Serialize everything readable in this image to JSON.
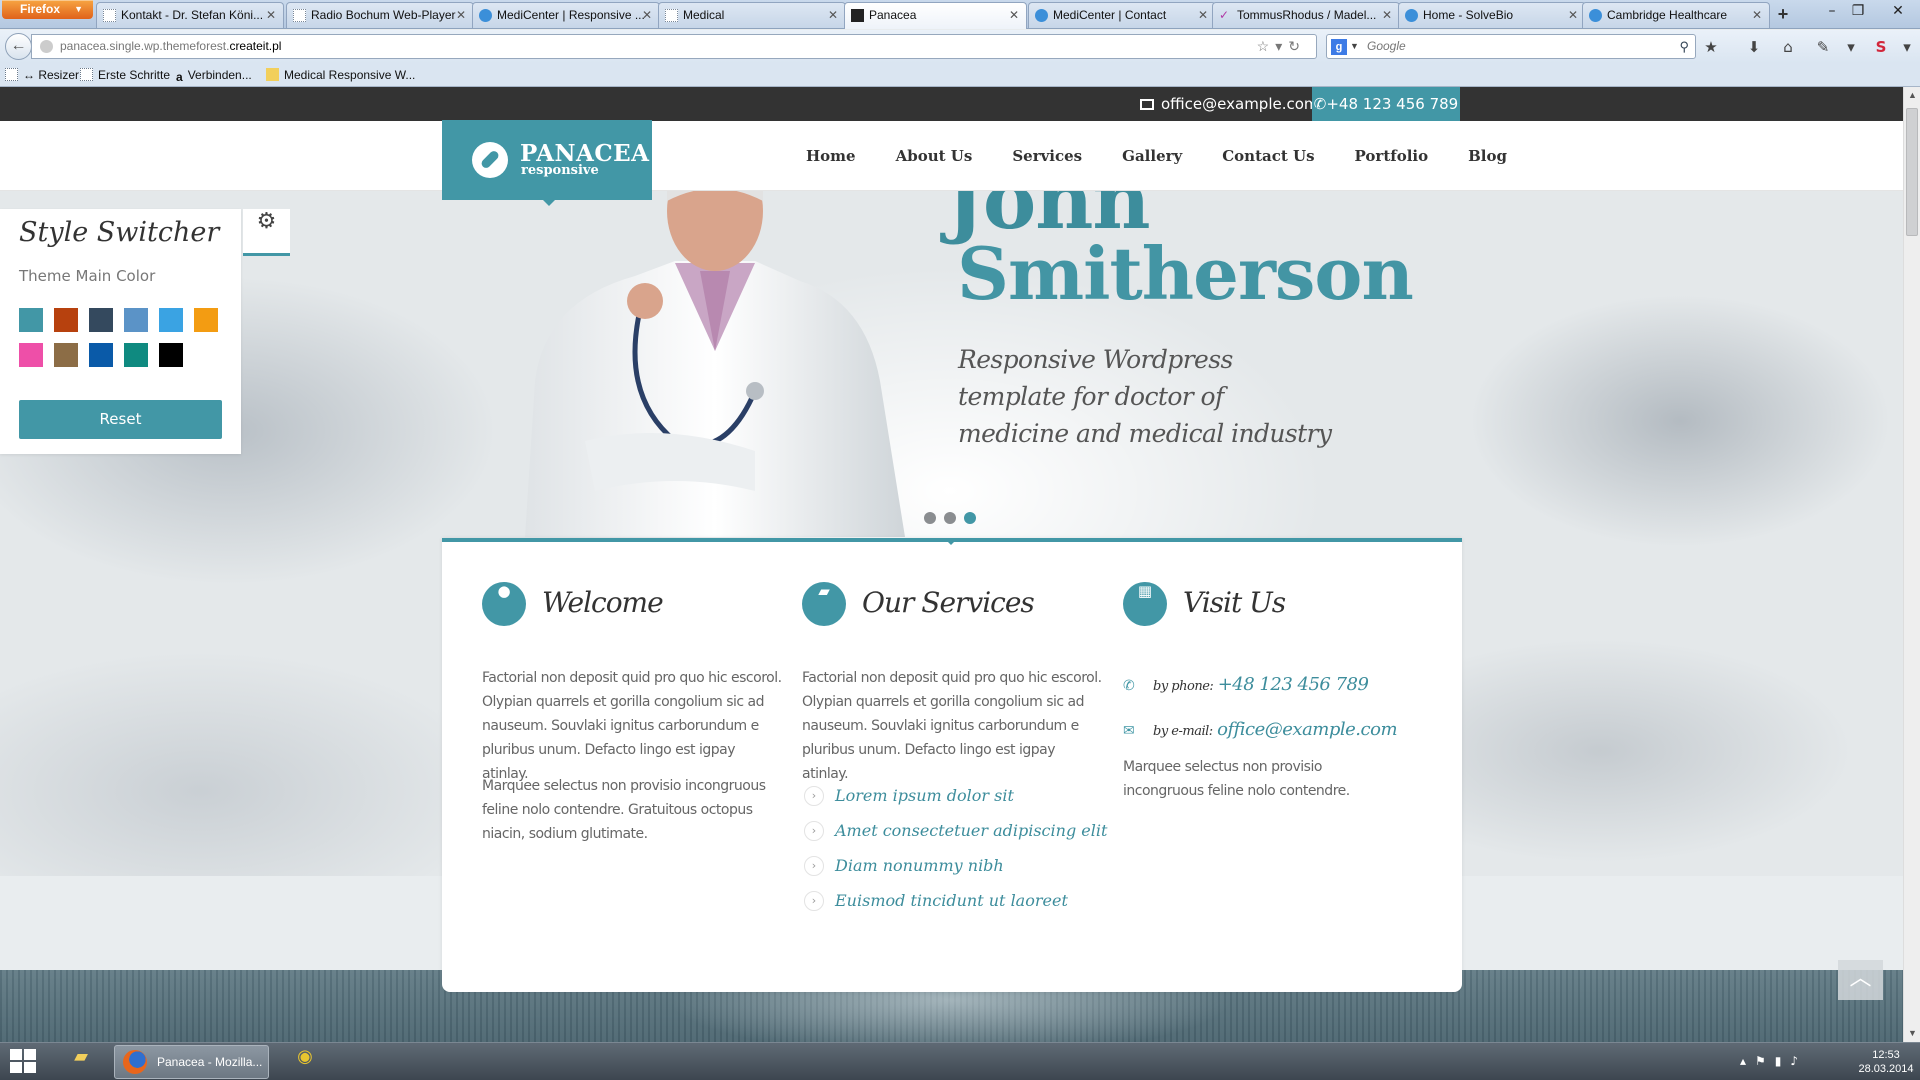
{
  "browser": {
    "menu_button": "Firefox",
    "tabs": [
      {
        "label": "Kontakt - Dr. Stefan Köni...",
        "active": false
      },
      {
        "label": "Radio Bochum Web-Player",
        "active": false
      },
      {
        "label": "MediCenter | Responsive ...",
        "active": false
      },
      {
        "label": "Medical",
        "active": false
      },
      {
        "label": "Panacea",
        "active": true
      },
      {
        "label": "MediCenter | Contact",
        "active": false
      },
      {
        "label": "TommusRhodus / Madel...",
        "active": false
      },
      {
        "label": "Home - SolveBio",
        "active": false
      },
      {
        "label": "Cambridge Healthcare",
        "active": false
      }
    ],
    "url_prefix": "panacea.single.wp.themeforest.",
    "url_host": "createit.pl",
    "search_placeholder": "Google",
    "bookmarks": [
      "↔ Resizer",
      "Erste Schritte",
      "Verbinden...",
      "Medical Responsive W..."
    ]
  },
  "site": {
    "email": "office@example.com",
    "phone": "+48 123 456 789",
    "logo_title": "PANACEA",
    "logo_sub": "responsive",
    "nav": [
      "Home",
      "About Us",
      "Services",
      "Gallery",
      "Contact Us",
      "Portfolio",
      "Blog"
    ]
  },
  "hero": {
    "first_name": "John",
    "last_name": "Smitherson",
    "tagline": "Responsive Wordpress template for doctor of medicine and medical industry",
    "dots": 3,
    "active_dot": 2
  },
  "style_switcher": {
    "title": "Style Switcher",
    "label": "Theme Main Color",
    "swatches": [
      "#4297a6",
      "#b7410e",
      "#34495e",
      "#5b93c7",
      "#3aa3e3",
      "#f39c12",
      "#ee4fa8",
      "#8c6d46",
      "#0a5aa8",
      "#0f8a80",
      "#000000"
    ],
    "reset_label": "Reset",
    "gear_icon": "gear-icon"
  },
  "columns": {
    "welcome": {
      "title": "Welcome",
      "icon": "user-icon",
      "para1": "Factorial non deposit quid pro quo hic escorol. Olypian quarrels et gorilla congolium sic ad nauseum. Souvlaki ignitus carborundum e pluribus unum. Defacto lingo est igpay atinlay.",
      "para2": "Marquee selectus non provisio incongruous feline nolo contendre. Gratuitous octopus niacin, sodium glutimate."
    },
    "services": {
      "title": "Our Services",
      "icon": "folder-icon",
      "para1": "Factorial non deposit quid pro quo hic escorol. Olypian quarrels et gorilla congolium sic ad nauseum. Souvlaki ignitus carborundum e pluribus unum. Defacto lingo est igpay atinlay.",
      "items": [
        "Lorem ipsum dolor sit",
        "Amet consectetuer adipiscing elit",
        "Diam nonummy nibh",
        "Euismod tincidunt ut laoreet"
      ]
    },
    "visit": {
      "title": "Visit Us",
      "icon": "calendar-icon",
      "phone_label": "by phone:",
      "phone": "+48 123 456 789",
      "email_label": "by e-mail:",
      "email": "office@example.com",
      "para": "Marquee selectus non provisio incongruous feline nolo contendre."
    }
  },
  "taskbar": {
    "firefox_task": "Panacea - Mozilla...",
    "time": "12:53",
    "date": "28.03.2014"
  }
}
